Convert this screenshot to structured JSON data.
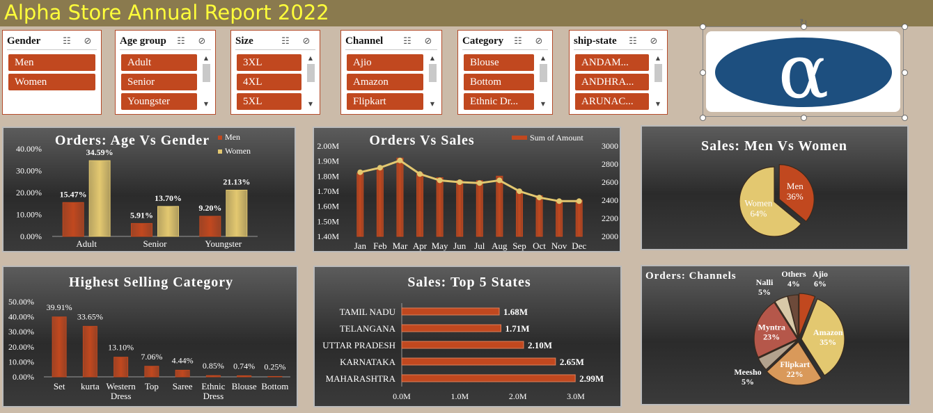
{
  "title": "Alpha Store Annual Report 2022",
  "colors": {
    "accent": "#c1481f",
    "gold": "#e3c870",
    "panel": "#3a3a3a",
    "title_text": "#ffff3a"
  },
  "slicers": [
    {
      "title": "Gender",
      "items": [
        "Men",
        "Women"
      ],
      "scroll": false
    },
    {
      "title": "Age group",
      "items": [
        "Adult",
        "Senior",
        "Youngster"
      ],
      "scroll": true
    },
    {
      "title": "Size",
      "items": [
        "3XL",
        "4XL",
        "5XL"
      ],
      "scroll": true
    },
    {
      "title": "Channel",
      "items": [
        "Ajio",
        "Amazon",
        "Flipkart"
      ],
      "scroll": true
    },
    {
      "title": "Category",
      "items": [
        "Blouse",
        "Bottom",
        "Ethnic Dr..."
      ],
      "scroll": true
    },
    {
      "title": "ship-state",
      "items": [
        "ANDAM...",
        "ANDHRA...",
        "ARUNAC..."
      ],
      "scroll": true
    }
  ],
  "logo": {
    "glyph": "α",
    "icon": "alpha-logo"
  },
  "chart_data": [
    {
      "id": "age_gender",
      "type": "bar",
      "title": "Orders: Age Vs Gender",
      "categories": [
        "Adult",
        "Senior",
        "Youngster"
      ],
      "series": [
        {
          "name": "Men",
          "values": [
            15.47,
            5.91,
            9.2
          ],
          "color": "#c1481f"
        },
        {
          "name": "Women",
          "values": [
            34.59,
            13.7,
            21.13
          ],
          "color": "#e3c870"
        }
      ],
      "data_labels": [
        [
          "15.47%",
          "5.91%",
          "9.20%"
        ],
        [
          "34.59%",
          "13.70%",
          "21.13%"
        ]
      ],
      "yticks": [
        "0.00%",
        "10.00%",
        "20.00%",
        "30.00%",
        "40.00%"
      ],
      "ylim": [
        0,
        40
      ],
      "legend": "top-right"
    },
    {
      "id": "orders_sales",
      "type": "bar",
      "title": "Orders Vs Sales",
      "categories": [
        "Jan",
        "Feb",
        "Mar",
        "Apr",
        "May",
        "Jun",
        "Jul",
        "Aug",
        "Sep",
        "Oct",
        "Nov",
        "Dec"
      ],
      "series": [
        {
          "name": "Sum of Amount",
          "values": [
            1.82,
            1.85,
            1.92,
            1.82,
            1.79,
            1.77,
            1.77,
            1.8,
            1.7,
            1.67,
            1.64,
            1.64
          ],
          "color": "#c1481f",
          "axis": "left"
        },
        {
          "values": [
            2710,
            2760,
            2840,
            2690,
            2620,
            2600,
            2590,
            2620,
            2500,
            2430,
            2390,
            2390
          ],
          "color": "#e3c870",
          "axis": "right"
        }
      ],
      "yticks_left": [
        "1.40M",
        "1.50M",
        "1.60M",
        "1.70M",
        "1.80M",
        "1.90M",
        "2.00M"
      ],
      "ylim_left": [
        1.4,
        2.0
      ],
      "yticks_right": [
        "2000",
        "2200",
        "2400",
        "2600",
        "2800",
        "3000"
      ],
      "ylim_right": [
        2000,
        3000
      ],
      "legend": "top-right"
    },
    {
      "id": "sales_gender",
      "type": "pie",
      "title": "Sales: Men Vs Women",
      "labels": [
        "Men",
        "Women"
      ],
      "values": [
        36,
        64
      ],
      "pct_labels": [
        "36%",
        "64%"
      ],
      "colors": [
        "#c1481f",
        "#e3c870"
      ]
    },
    {
      "id": "category",
      "type": "bar",
      "title": "Highest Selling Category",
      "categories": [
        "Set",
        "kurta",
        "Western Dress",
        "Top",
        "Saree",
        "Ethnic Dress",
        "Blouse",
        "Bottom"
      ],
      "values": [
        39.91,
        33.65,
        13.1,
        7.06,
        4.44,
        0.85,
        0.74,
        0.25
      ],
      "data_labels": [
        "39.91%",
        "33.65%",
        "13.10%",
        "7.06%",
        "4.44%",
        "0.85%",
        "0.74%",
        "0.25%"
      ],
      "yticks": [
        "0.00%",
        "10.00%",
        "20.00%",
        "30.00%",
        "40.00%",
        "50.00%"
      ],
      "ylim": [
        0,
        50
      ]
    },
    {
      "id": "top_states",
      "type": "bar",
      "orientation": "horizontal",
      "title": "Sales: Top 5 States",
      "categories": [
        "TAMIL NADU",
        "TELANGANA",
        "UTTAR PRADESH",
        "KARNATAKA",
        "MAHARASHTRA"
      ],
      "values": [
        1.68,
        1.71,
        2.1,
        2.65,
        2.99
      ],
      "data_labels": [
        "1.68M",
        "1.71M",
        "2.10M",
        "2.65M",
        "2.99M"
      ],
      "xticks": [
        "0.0M",
        "1.0M",
        "2.0M",
        "3.0M"
      ],
      "xlim": [
        0,
        3.0
      ]
    },
    {
      "id": "channels",
      "type": "pie",
      "title": "Orders: Channels",
      "labels": [
        "Ajio",
        "Amazon",
        "Flipkart",
        "Meesho",
        "Myntra",
        "Nalli",
        "Others"
      ],
      "values": [
        6,
        35,
        22,
        5,
        23,
        5,
        4
      ],
      "pct_labels": [
        "6%",
        "35%",
        "22%",
        "5%",
        "23%",
        "5%",
        "4%"
      ],
      "colors": [
        "#c1481f",
        "#e3c870",
        "#d9995a",
        "#b3a28e",
        "#b5574a",
        "#d8c9a8",
        "#6d4a3a"
      ]
    }
  ]
}
